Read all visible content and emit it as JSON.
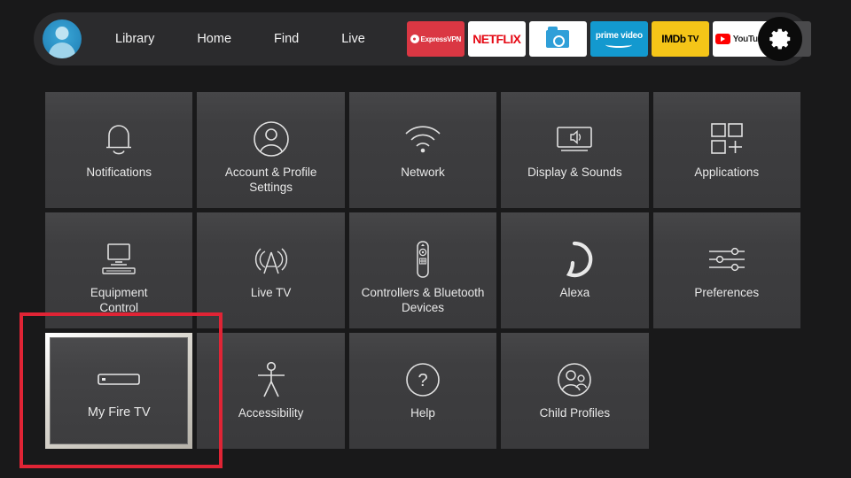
{
  "nav": {
    "avatar": "profile-avatar",
    "links": [
      {
        "label": "Library"
      },
      {
        "label": "Home"
      },
      {
        "label": "Find"
      },
      {
        "label": "Live"
      }
    ],
    "apps": [
      {
        "name": "expressvpn",
        "label": "ExpressVPN",
        "mark": "e",
        "bg": "#da3743"
      },
      {
        "name": "netflix",
        "label": "NETFLIX",
        "bg": "#ffffff",
        "accent": "#e50914"
      },
      {
        "name": "files",
        "label": "",
        "bg": "#ffffff",
        "accent": "#2f9fd8"
      },
      {
        "name": "prime-video",
        "label": "prime video",
        "bg": "#1399cf"
      },
      {
        "name": "imdb-tv",
        "label": "IMDb",
        "label2": "TV",
        "bg": "#f5c518"
      },
      {
        "name": "youtube",
        "label": "YouTube",
        "bg": "#ffffff",
        "accent": "#ff0000"
      }
    ],
    "more_label": "more-options",
    "settings_label": "settings-gear"
  },
  "grid": {
    "tiles": [
      {
        "name": "notifications",
        "label": "Notifications",
        "icon": "bell-icon"
      },
      {
        "name": "account-profile",
        "label": "Account & Profile\nSettings",
        "icon": "person-circle-icon"
      },
      {
        "name": "network",
        "label": "Network",
        "icon": "wifi-icon"
      },
      {
        "name": "display-sounds",
        "label": "Display & Sounds",
        "icon": "tv-speaker-icon"
      },
      {
        "name": "applications",
        "label": "Applications",
        "icon": "apps-grid-icon"
      },
      {
        "name": "equipment-control",
        "label": "Equipment\nControl",
        "icon": "monitor-keyboard-icon"
      },
      {
        "name": "live-tv",
        "label": "Live TV",
        "icon": "antenna-icon"
      },
      {
        "name": "controllers-bluetooth",
        "label": "Controllers & Bluetooth\nDevices",
        "icon": "remote-icon"
      },
      {
        "name": "alexa",
        "label": "Alexa",
        "icon": "alexa-ring-icon"
      },
      {
        "name": "preferences",
        "label": "Preferences",
        "icon": "sliders-icon"
      },
      {
        "name": "my-fire-tv",
        "label": "My Fire TV",
        "icon": "fire-tv-stick-icon",
        "selected": true
      },
      {
        "name": "accessibility",
        "label": "Accessibility",
        "icon": "accessibility-person-icon"
      },
      {
        "name": "help",
        "label": "Help",
        "icon": "question-circle-icon"
      },
      {
        "name": "child-profiles",
        "label": "Child Profiles",
        "icon": "two-people-circle-icon"
      }
    ]
  },
  "annotation": {
    "target": "my-fire-tv",
    "color": "#e02435"
  },
  "colors": {
    "page_bg": "#19191a",
    "navbar_bg": "#2b2b2d",
    "tile_bg": "#3e3e40",
    "text": "#e9e9e9",
    "highlight": "#e02435"
  }
}
